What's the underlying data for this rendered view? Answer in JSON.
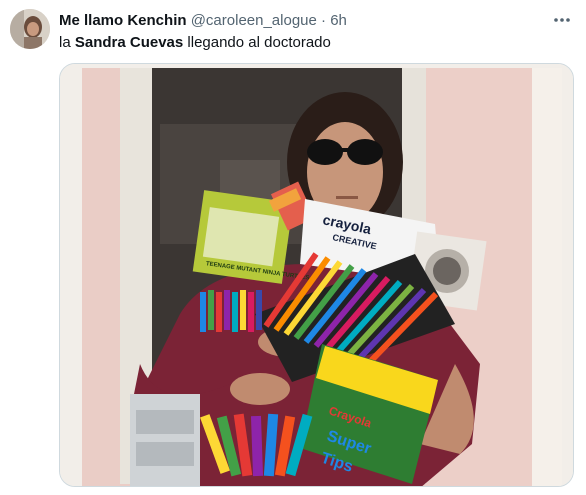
{
  "author": {
    "display_name": "Me llamo Kenchin",
    "handle": "@caroleen_alogue",
    "separator": "·",
    "time": "6h"
  },
  "tweet": {
    "text_before": "la ",
    "text_bold": "Sandra Cuevas",
    "text_after": " llegando al doctorado"
  },
  "media": {
    "box_brand": "crayola",
    "box_subtitle": "CREATIVE",
    "marker_brand": "Crayola",
    "marker_product_line1": "Super",
    "marker_product_line2": "Tips",
    "kit_label": "TEENAGE MUTANT NINJA TURTLES"
  },
  "icons": {
    "more": "more-horizontal-icon"
  },
  "colors": {
    "text_primary": "#0f1419",
    "text_secondary": "#536471",
    "border": "#cfd9de"
  }
}
